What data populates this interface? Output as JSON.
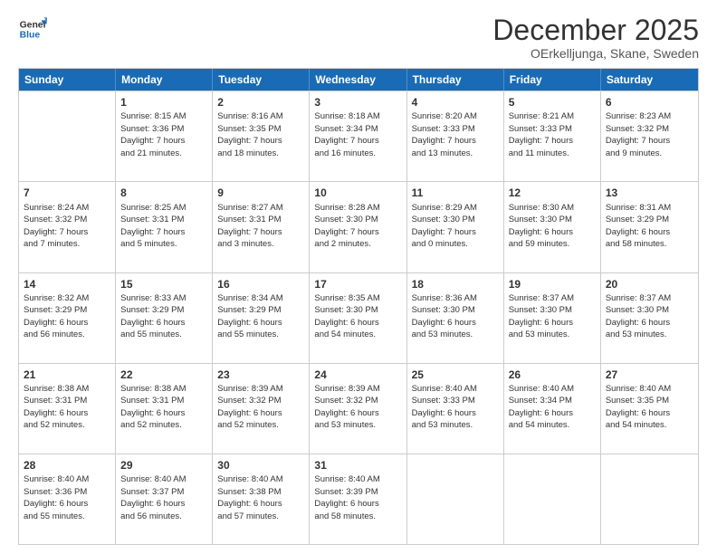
{
  "logo": {
    "line1": "General",
    "line2": "Blue"
  },
  "title": "December 2025",
  "subtitle": "OErkelljunga, Skane, Sweden",
  "days": [
    "Sunday",
    "Monday",
    "Tuesday",
    "Wednesday",
    "Thursday",
    "Friday",
    "Saturday"
  ],
  "weeks": [
    [
      {
        "num": "",
        "text": ""
      },
      {
        "num": "1",
        "text": "Sunrise: 8:15 AM\nSunset: 3:36 PM\nDaylight: 7 hours\nand 21 minutes."
      },
      {
        "num": "2",
        "text": "Sunrise: 8:16 AM\nSunset: 3:35 PM\nDaylight: 7 hours\nand 18 minutes."
      },
      {
        "num": "3",
        "text": "Sunrise: 8:18 AM\nSunset: 3:34 PM\nDaylight: 7 hours\nand 16 minutes."
      },
      {
        "num": "4",
        "text": "Sunrise: 8:20 AM\nSunset: 3:33 PM\nDaylight: 7 hours\nand 13 minutes."
      },
      {
        "num": "5",
        "text": "Sunrise: 8:21 AM\nSunset: 3:33 PM\nDaylight: 7 hours\nand 11 minutes."
      },
      {
        "num": "6",
        "text": "Sunrise: 8:23 AM\nSunset: 3:32 PM\nDaylight: 7 hours\nand 9 minutes."
      }
    ],
    [
      {
        "num": "7",
        "text": "Sunrise: 8:24 AM\nSunset: 3:32 PM\nDaylight: 7 hours\nand 7 minutes."
      },
      {
        "num": "8",
        "text": "Sunrise: 8:25 AM\nSunset: 3:31 PM\nDaylight: 7 hours\nand 5 minutes."
      },
      {
        "num": "9",
        "text": "Sunrise: 8:27 AM\nSunset: 3:31 PM\nDaylight: 7 hours\nand 3 minutes."
      },
      {
        "num": "10",
        "text": "Sunrise: 8:28 AM\nSunset: 3:30 PM\nDaylight: 7 hours\nand 2 minutes."
      },
      {
        "num": "11",
        "text": "Sunrise: 8:29 AM\nSunset: 3:30 PM\nDaylight: 7 hours\nand 0 minutes."
      },
      {
        "num": "12",
        "text": "Sunrise: 8:30 AM\nSunset: 3:30 PM\nDaylight: 6 hours\nand 59 minutes."
      },
      {
        "num": "13",
        "text": "Sunrise: 8:31 AM\nSunset: 3:29 PM\nDaylight: 6 hours\nand 58 minutes."
      }
    ],
    [
      {
        "num": "14",
        "text": "Sunrise: 8:32 AM\nSunset: 3:29 PM\nDaylight: 6 hours\nand 56 minutes."
      },
      {
        "num": "15",
        "text": "Sunrise: 8:33 AM\nSunset: 3:29 PM\nDaylight: 6 hours\nand 55 minutes."
      },
      {
        "num": "16",
        "text": "Sunrise: 8:34 AM\nSunset: 3:29 PM\nDaylight: 6 hours\nand 55 minutes."
      },
      {
        "num": "17",
        "text": "Sunrise: 8:35 AM\nSunset: 3:30 PM\nDaylight: 6 hours\nand 54 minutes."
      },
      {
        "num": "18",
        "text": "Sunrise: 8:36 AM\nSunset: 3:30 PM\nDaylight: 6 hours\nand 53 minutes."
      },
      {
        "num": "19",
        "text": "Sunrise: 8:37 AM\nSunset: 3:30 PM\nDaylight: 6 hours\nand 53 minutes."
      },
      {
        "num": "20",
        "text": "Sunrise: 8:37 AM\nSunset: 3:30 PM\nDaylight: 6 hours\nand 53 minutes."
      }
    ],
    [
      {
        "num": "21",
        "text": "Sunrise: 8:38 AM\nSunset: 3:31 PM\nDaylight: 6 hours\nand 52 minutes."
      },
      {
        "num": "22",
        "text": "Sunrise: 8:38 AM\nSunset: 3:31 PM\nDaylight: 6 hours\nand 52 minutes."
      },
      {
        "num": "23",
        "text": "Sunrise: 8:39 AM\nSunset: 3:32 PM\nDaylight: 6 hours\nand 52 minutes."
      },
      {
        "num": "24",
        "text": "Sunrise: 8:39 AM\nSunset: 3:32 PM\nDaylight: 6 hours\nand 53 minutes."
      },
      {
        "num": "25",
        "text": "Sunrise: 8:40 AM\nSunset: 3:33 PM\nDaylight: 6 hours\nand 53 minutes."
      },
      {
        "num": "26",
        "text": "Sunrise: 8:40 AM\nSunset: 3:34 PM\nDaylight: 6 hours\nand 54 minutes."
      },
      {
        "num": "27",
        "text": "Sunrise: 8:40 AM\nSunset: 3:35 PM\nDaylight: 6 hours\nand 54 minutes."
      }
    ],
    [
      {
        "num": "28",
        "text": "Sunrise: 8:40 AM\nSunset: 3:36 PM\nDaylight: 6 hours\nand 55 minutes."
      },
      {
        "num": "29",
        "text": "Sunrise: 8:40 AM\nSunset: 3:37 PM\nDaylight: 6 hours\nand 56 minutes."
      },
      {
        "num": "30",
        "text": "Sunrise: 8:40 AM\nSunset: 3:38 PM\nDaylight: 6 hours\nand 57 minutes."
      },
      {
        "num": "31",
        "text": "Sunrise: 8:40 AM\nSunset: 3:39 PM\nDaylight: 6 hours\nand 58 minutes."
      },
      {
        "num": "",
        "text": ""
      },
      {
        "num": "",
        "text": ""
      },
      {
        "num": "",
        "text": ""
      }
    ]
  ]
}
